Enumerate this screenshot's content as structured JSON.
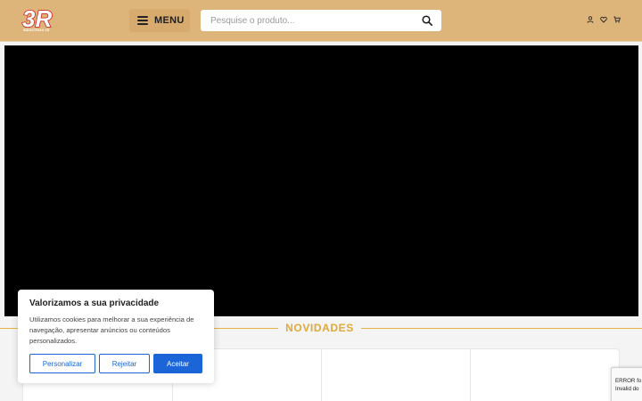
{
  "header": {
    "logo_text": "INDÚSTRIAS 3R",
    "menu_label": "MENU",
    "search_placeholder": "Pesquise o produto..."
  },
  "section": {
    "title": "NOVIDADES"
  },
  "cookie_banner": {
    "title": "Valorizamos a sua privacidade",
    "text": "Utilizamos cookies para melhorar a sua experiência de navegação, apresentar anúncios ou conteúdos personalizados.",
    "buttons": {
      "customize": "Personalizar",
      "reject": "Rejeitar",
      "accept": "Aceitar"
    }
  },
  "recaptcha": {
    "line1": "ERROR fo",
    "line2": "Invalid do"
  },
  "colors": {
    "header_bg": "#ddb57b",
    "accent_gold": "#e0a93a",
    "brand_red": "#c81e1e",
    "button_blue": "#1c65d8"
  },
  "icons": {
    "menu": "hamburger-icon",
    "search": "search-icon",
    "account": "user-icon",
    "wishlist": "heart-icon",
    "cart": "cart-icon"
  }
}
